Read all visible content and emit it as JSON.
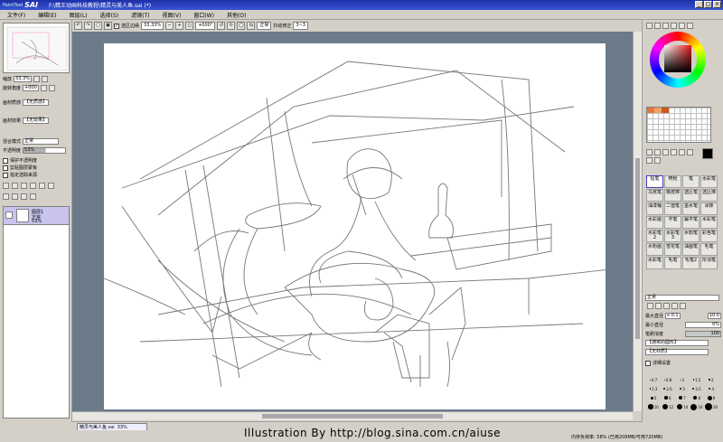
{
  "window": {
    "app_prefix": "PaintTool",
    "app_name": "SAI",
    "title": "F:\\精王动画科技教程\\精灵与美人鱼.sai (*)"
  },
  "menu": [
    "文件(F)",
    "编辑(E)",
    "图层(L)",
    "选择(S)",
    "滤镜(T)",
    "视图(V)",
    "窗口(W)",
    "其他(O)"
  ],
  "toolbar": {
    "selection_edge": "选区边缘",
    "zoom": "33.33%",
    "angle": "+000°",
    "mode": "正常",
    "stabilizer_label": "抖动修正",
    "stabilizer": "3~3"
  },
  "left": {
    "zoom_label": "缩放",
    "zoom_value": "33.3%",
    "angle_label": "旋转角度",
    "angle_value": "+000",
    "paper_texture_label": "画材质感",
    "paper_texture": "【无质感】",
    "paper_effect_label": "画材效果",
    "paper_effect": "【无效果】",
    "blend_label": "混合模式",
    "blend": "正常",
    "opacity_label": "不透明度",
    "opacity": "53%",
    "opt1": "保护不透明度",
    "opt2": "剪贴图层蒙板",
    "opt3": "指定选取来源",
    "layer_name": "图层1",
    "layer_mode": "正常",
    "layer_opacity": "53%"
  },
  "right": {
    "tools": [
      "铅笔",
      "喷枪",
      "笔",
      "水彩笔",
      "马克笔",
      "橡皮擦",
      "选区笔",
      "选区擦",
      "油漆桶",
      "二值笔",
      "墨水笔",
      "涂抹",
      "水彩画",
      "平笔",
      "扁平笔",
      "水彩笔",
      "水彩笔2",
      "水彩笔3",
      "水粉笔",
      "彩色笔",
      "水粉画",
      "雪花笔",
      "油画笔",
      "毛笔",
      "水彩笔",
      "毛笔",
      "毛笔2",
      "厚涂笔"
    ],
    "mode": "正常",
    "max_size_label": "最大直径",
    "max_size_mult": "x 0.1",
    "max_size": "10.0",
    "min_size_label": "最小直径",
    "min_size": "0%",
    "density_label": "笔刷浓度",
    "density": "100",
    "shape": "【通常的圆形】",
    "texture": "【无材质】",
    "detail_label": "详细设置",
    "size_labels": [
      "0.7",
      "0.8",
      "1",
      "1.5",
      "2",
      "2.3",
      "2.6",
      "3",
      "3.5",
      "4",
      "5",
      "6",
      "7",
      "8",
      "9",
      "10",
      "12",
      "14",
      "16",
      "20"
    ]
  },
  "tabs": [
    {
      "name": "精灵与美人鱼.sai",
      "zoom": "33%"
    }
  ],
  "status": {
    "memory": "内存负荷率: 58% (已用209MB/可用720MB)",
    "credit": "Illustration  By  http://blog.sina.com.cn/aiuse"
  },
  "colors": {
    "title_bg": "#2a40c0",
    "panel_bg": "#d4d0c8",
    "canvas_bg": "#6b7b8a",
    "layer_selected": "#c8c4ee"
  }
}
